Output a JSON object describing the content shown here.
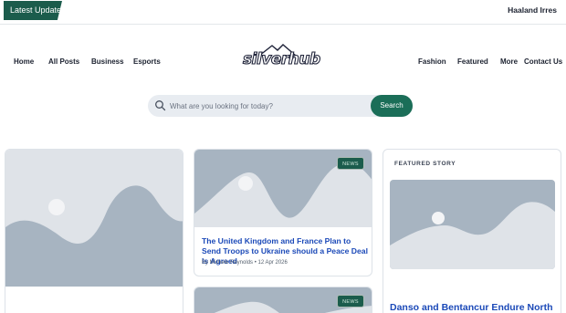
{
  "topbar": {
    "latest_label": "Latest Update",
    "ticker_text": "Haaland Irres"
  },
  "nav": {
    "left": [
      "Home",
      "All Posts",
      "Business",
      "Esports"
    ],
    "right": [
      "Fashion",
      "Featured",
      "More",
      "Contact Us"
    ],
    "logo_text": "silverhub"
  },
  "search": {
    "placeholder": "What are you looking for today?",
    "button_label": "Search"
  },
  "posts": [
    {
      "badge": "NEWS",
      "title": "The United Kingdom and France Plan to Send Troops to Ukraine should a Peace Deal Is Agreed",
      "author": "By Michele Reynolds",
      "date": "12 Apr 2026"
    },
    {
      "badge": "NEWS"
    }
  ],
  "featured": {
    "label": "FEATURED STORY",
    "title": "Danso and Bentancur Endure North"
  },
  "colors": {
    "accent_green": "#1b5c4c",
    "button_green": "#1b6e58",
    "title_blue": "#1b49b8",
    "placeholder_bg": "#d7dde4"
  }
}
